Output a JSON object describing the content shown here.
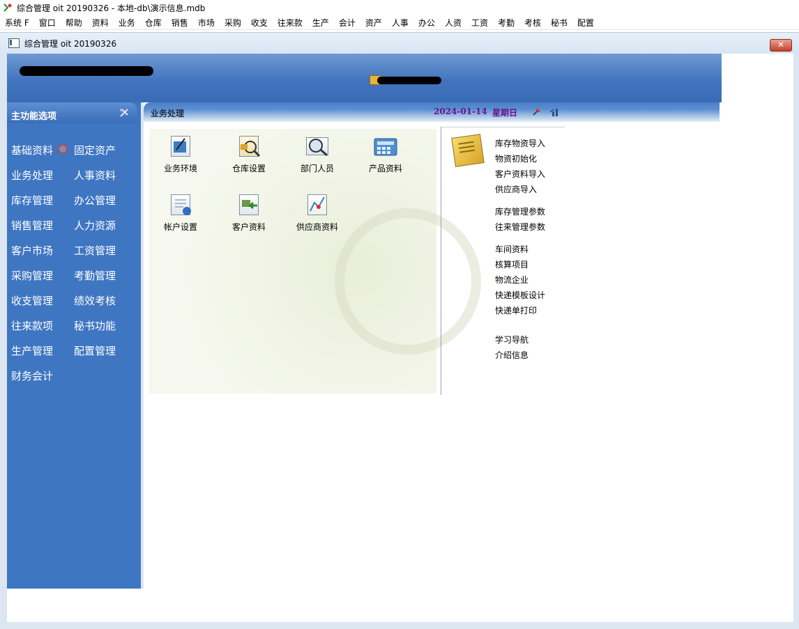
{
  "app": {
    "title": "综合管理 oit 20190326 - 本地-db\\演示信息.mdb"
  },
  "menu": [
    "系统 F",
    "窗口",
    "帮助",
    "资料",
    "业务",
    "仓库",
    "销售",
    "市场",
    "采购",
    "收支",
    "往来款",
    "生产",
    "会计",
    "资产",
    "人事",
    "办公",
    "人资",
    "工资",
    "考勤",
    "考核",
    "秘书",
    "配置"
  ],
  "child_window": {
    "title": "综合管理 oit 20190326",
    "close_label": "✕"
  },
  "sidebar": {
    "header": "主功能选项",
    "col1": [
      "基础资料",
      "业务处理",
      "库存管理",
      "销售管理",
      "客户市场",
      "采购管理",
      "收支管理",
      "往来款项",
      "生产管理",
      "财务会计"
    ],
    "col2": [
      "固定资产",
      "人事资料",
      "办公管理",
      "人力资源",
      "工资管理",
      "考勤管理",
      "绩效考核",
      "秘书功能",
      "配置管理"
    ]
  },
  "content": {
    "title": "业务处理",
    "date": "2024-01-14",
    "weekday": "星期日",
    "tiles": [
      "业务环境",
      "仓库设置",
      "部门人员",
      "产品资料",
      "帐户设置",
      "客户资料",
      "供应商资料"
    ],
    "links_group1": [
      "库存物资导入",
      "物资初始化",
      "客户资料导入",
      "供应商导入"
    ],
    "links_group2": [
      "库存管理参数",
      "往来管理参数"
    ],
    "links_group3": [
      "车间资料",
      "核算项目",
      "物流企业",
      "快递模板设计",
      "快递单打印"
    ],
    "links_group4": [
      "学习导航",
      "介绍信息"
    ]
  },
  "icons": {
    "app": "app-logo-icon",
    "swap": "swap-icon",
    "settings": "settings-icon",
    "pin": "pin-icon",
    "chart": "chart-icon",
    "notes": "notes-icon"
  },
  "colors": {
    "accent": "#3f76c2",
    "date": "#6a138f"
  }
}
